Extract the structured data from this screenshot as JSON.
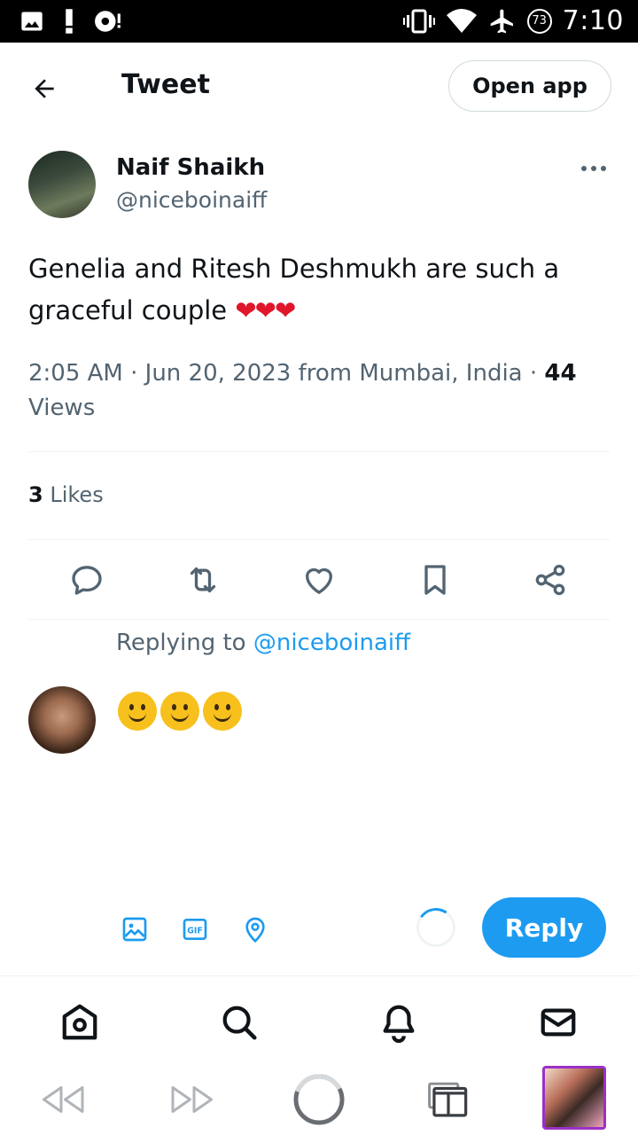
{
  "status_bar": {
    "time": "7:10",
    "battery_level": "73",
    "icons": [
      "image-icon",
      "alert-icon",
      "cast-icon",
      "vibrate-icon",
      "wifi-icon",
      "airplane-icon",
      "battery-saver-icon"
    ]
  },
  "header": {
    "title": "Tweet",
    "open_app_label": "Open app"
  },
  "tweet": {
    "author_name": "Naif Shaikh",
    "author_handle": "@niceboinaiff",
    "text": "Genelia and Ritesh Deshmukh are such a graceful couple ",
    "emoji": "❤❤❤",
    "time": "2:05 AM · Jun 20, 2023 from Mumbai, India · ",
    "views_count": "44",
    "views_label": "Views",
    "likes_count": "3",
    "likes_label": "Likes"
  },
  "actions": [
    "reply-icon",
    "retweet-icon",
    "like-icon",
    "bookmark-icon",
    "share-icon"
  ],
  "reply": {
    "replying_prefix": "Replying to ",
    "replying_handle": "@niceboinaiff",
    "emoji_count": 3
  },
  "composer": {
    "reply_label": "Reply",
    "gif_label": "GIF"
  },
  "colors": {
    "accent": "#1d9bf0",
    "text": "#0f1419",
    "secondary": "#536471",
    "heart": "#e0162b",
    "tab_border": "#9b30c8"
  }
}
